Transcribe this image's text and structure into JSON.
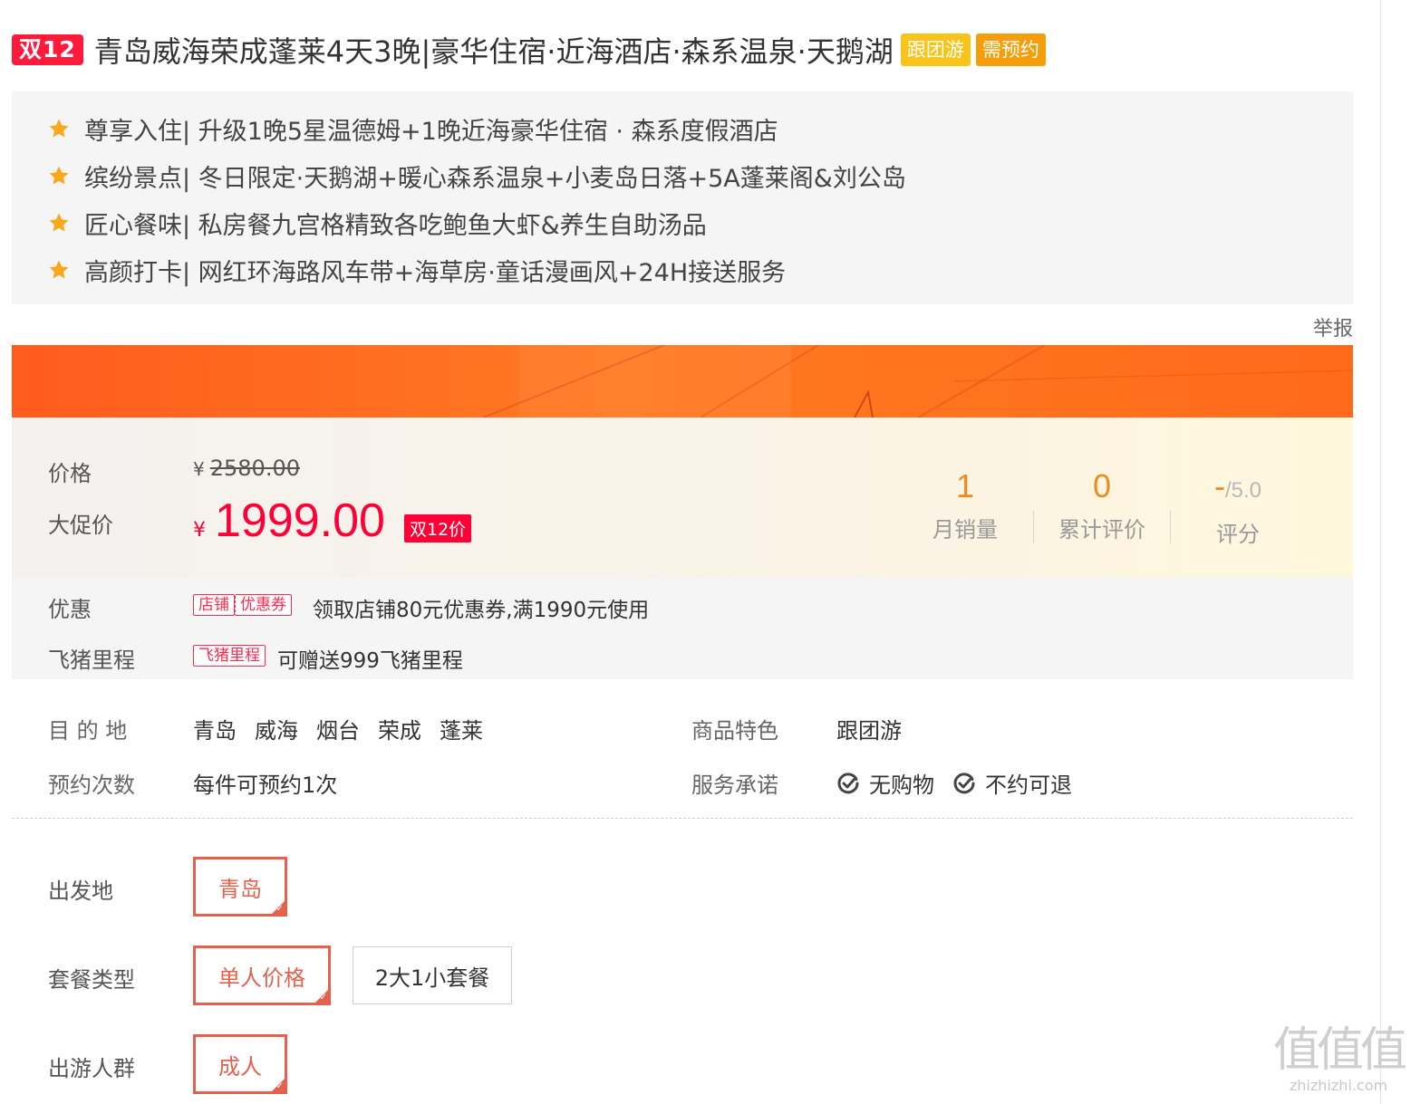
{
  "title": {
    "badge": "双12",
    "text": "青岛威海荣成蓬莱4天3晚|豪华住宿·近海酒店·森系温泉·天鹅湖",
    "tags": [
      "跟团游",
      "需预约"
    ]
  },
  "highlights": [
    "尊享入住| 升级1晚5星温德姆+1晚近海豪华住宿 · 森系度假酒店",
    "缤纷景点| 冬日限定·天鹅湖+暖心森系温泉+小麦岛日落+5A蓬莱阁&刘公岛",
    "匠心餐味| 私房餐九宫格精致各吃鲍鱼大虾&养生自助汤品",
    "高颜打卡| 网红环海路风车带+海草房·童话漫画风+24H接送服务"
  ],
  "report_label": "举报",
  "price": {
    "label": "价格",
    "currency": "¥",
    "original": "2580.00",
    "promo_label": "大促价",
    "promo": "1999.00",
    "promo_badge": "双12价"
  },
  "stats": {
    "monthly_sales": {
      "value": "1",
      "label": "月销量"
    },
    "reviews": {
      "value": "0",
      "label": "累计评价"
    },
    "rating": {
      "value": "-",
      "suffix": "/5.0",
      "label": "评分"
    }
  },
  "offers": {
    "coupon_label": "优惠",
    "coupon_tags": [
      "店铺",
      "优惠券"
    ],
    "coupon_text": "领取店铺80元优惠券,满1990元使用",
    "mileage_label": "飞猪里程",
    "mileage_tag": "飞猪里程",
    "mileage_text": "可赠送999飞猪里程"
  },
  "info": {
    "destination_label": "目 的 地",
    "destinations": [
      "青岛",
      "威海",
      "烟台",
      "荣成",
      "蓬莱"
    ],
    "feature_label": "商品特色",
    "feature_value": "跟团游",
    "booking_label": "预约次数",
    "booking_value": "每件可预约1次",
    "promise_label": "服务承诺",
    "promises": [
      "无购物",
      "不约可退"
    ]
  },
  "options": {
    "departure_label": "出发地",
    "departure": [
      "青岛"
    ],
    "package_label": "套餐类型",
    "packages": [
      "单人价格",
      "2大1小套餐"
    ],
    "crowd_label": "出游人群",
    "crowd": [
      "成人"
    ]
  },
  "watermark": {
    "big": "值值值",
    "small": "zhizhizhi.com"
  },
  "colors": {
    "accent_red": "#ff0036",
    "banner_orange": "#ff6a1a",
    "selected_border": "#e5614e",
    "stat_orange": "#ee8a22"
  }
}
